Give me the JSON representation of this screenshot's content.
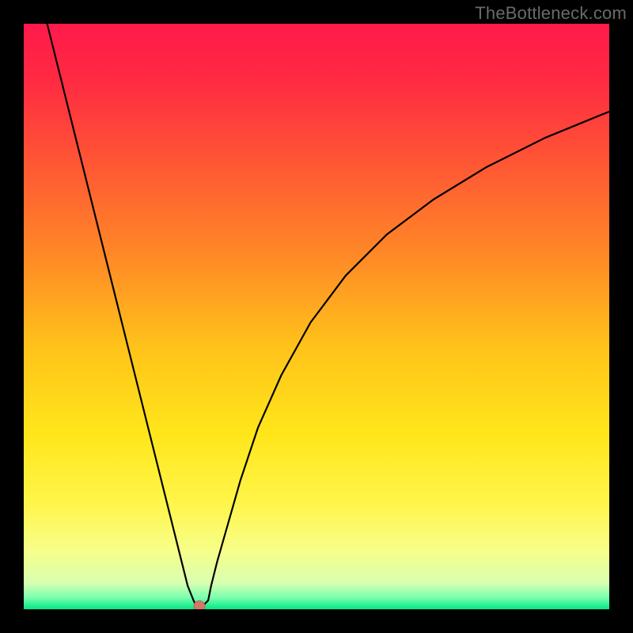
{
  "watermark": "TheBottleneck.com",
  "chart_data": {
    "type": "line",
    "title": "",
    "xlabel": "",
    "ylabel": "",
    "xlim": [
      0,
      100
    ],
    "ylim": [
      0,
      100
    ],
    "grid": false,
    "background_gradient": {
      "stops": [
        {
          "pos": 0.0,
          "color": "#ff1a4b"
        },
        {
          "pos": 0.1,
          "color": "#ff2b42"
        },
        {
          "pos": 0.25,
          "color": "#ff5a33"
        },
        {
          "pos": 0.4,
          "color": "#ff8a26"
        },
        {
          "pos": 0.55,
          "color": "#ffc21a"
        },
        {
          "pos": 0.7,
          "color": "#ffe61a"
        },
        {
          "pos": 0.82,
          "color": "#fff54a"
        },
        {
          "pos": 0.9,
          "color": "#f7ff8a"
        },
        {
          "pos": 0.955,
          "color": "#d8ffb0"
        },
        {
          "pos": 0.98,
          "color": "#7bffb0"
        },
        {
          "pos": 1.0,
          "color": "#00e884"
        }
      ]
    },
    "series": [
      {
        "name": "curve",
        "color": "#000000",
        "x": [
          4.0,
          6.5,
          9.0,
          11.5,
          14.0,
          16.5,
          19.0,
          21.5,
          24.0,
          25.5,
          27.0,
          28.0,
          29.0,
          29.5,
          30.5,
          31.5,
          32.0,
          33.0,
          35.0,
          37.0,
          40.0,
          44.0,
          49.0,
          55.0,
          62.0,
          70.0,
          79.0,
          89.0,
          100.0
        ],
        "y": [
          100.0,
          90.0,
          80.0,
          70.0,
          60.0,
          50.0,
          40.0,
          30.0,
          20.0,
          14.0,
          8.0,
          4.0,
          1.5,
          0.5,
          0.5,
          1.5,
          4.0,
          8.0,
          15.0,
          22.0,
          31.0,
          40.0,
          49.0,
          57.0,
          64.0,
          70.0,
          75.5,
          80.5,
          85.0
        ]
      }
    ],
    "marker": {
      "name": "dot",
      "x": 30.0,
      "y": 0.5,
      "radius_px": 7,
      "fill": "#cf7a66",
      "stroke": "#b86a58"
    }
  }
}
